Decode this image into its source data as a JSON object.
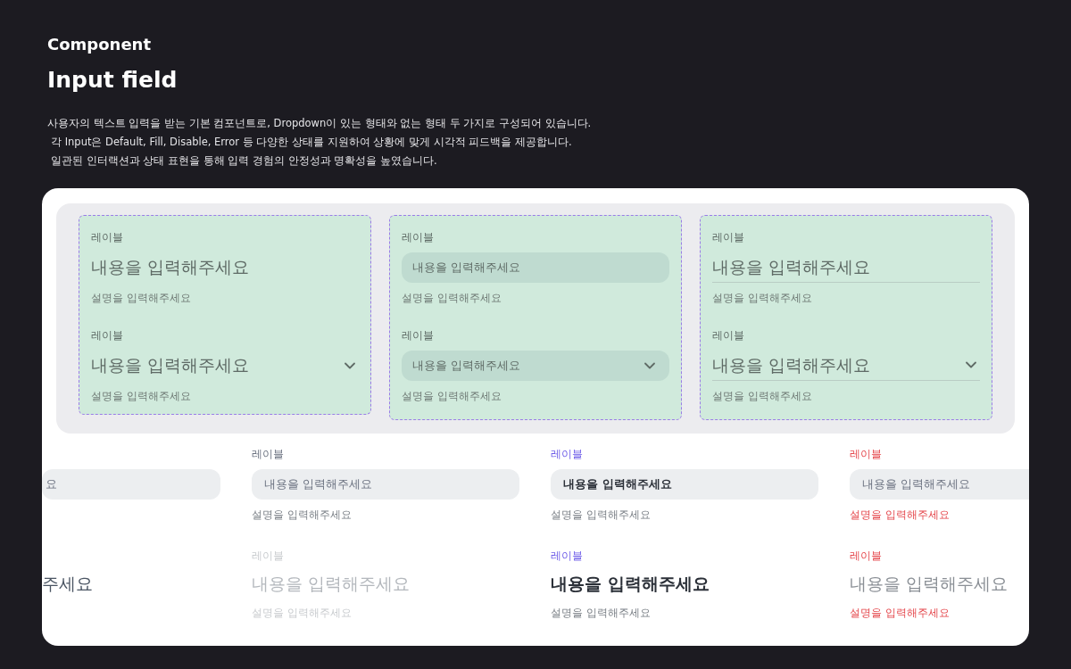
{
  "header": {
    "eyebrow": "Component",
    "title": "Input field",
    "description": [
      "사용자의 텍스트 입력을 받는 기본 컴포넌트로, Dropdown이 있는 형태와 없는 형태 두 가지로 구성되어 있습니다.",
      "각 Input은 Default, Fill, Disable, Error 등 다양한 상태를 지원하여 상황에 맞게 시각적 피드백을 제공합니다.",
      "일관된 인터랙션과 상태 표현을 통해 입력 경험의 안정성과 명확성을 높였습니다."
    ]
  },
  "variants": [
    {
      "kind": "plain",
      "fields": [
        {
          "label": "레이블",
          "value": "내용을 입력해주세요",
          "description": "설명을 입력해주세요",
          "dropdown": false
        },
        {
          "label": "레이블",
          "value": "내용을 입력해주세요",
          "description": "설명을 입력해주세요",
          "dropdown": true
        }
      ]
    },
    {
      "kind": "filled",
      "fields": [
        {
          "label": "레이블",
          "value": "내용을 입력해주세요",
          "description": "설명을 입력해주세요",
          "dropdown": false
        },
        {
          "label": "레이블",
          "value": "내용을 입력해주세요",
          "description": "설명을 입력해주세요",
          "dropdown": true
        }
      ]
    },
    {
      "kind": "underline",
      "fields": [
        {
          "label": "레이블",
          "value": "내용을 입력해주세요",
          "description": "설명을 입력해주세요",
          "dropdown": false
        },
        {
          "label": "레이블",
          "value": "내용을 입력해주세요",
          "description": "설명을 입력해주세요",
          "dropdown": true
        }
      ]
    }
  ],
  "state_columns": [
    {
      "box": {
        "kind": "default",
        "value": "요"
      },
      "line": {
        "kind": "filled",
        "value": "주세요"
      }
    },
    {
      "box": {
        "kind": "default",
        "label": "레이블",
        "value": "내용을 입력해주세요",
        "description": "설명을 입력해주세요"
      },
      "line": {
        "kind": "disabled",
        "label": "레이블",
        "value": "내용을 입력해주세요",
        "description": "설명을 입력해주세요"
      }
    },
    {
      "box": {
        "kind": "focused",
        "label": "레이블",
        "value": "내용을 입력해주세요",
        "description": "설명을 입력해주세요"
      },
      "line": {
        "kind": "focused",
        "label": "레이블",
        "value": "내용을 입력해주세요",
        "description": "설명을 입력해주세요"
      }
    },
    {
      "box": {
        "kind": "error",
        "label": "레이블",
        "value": "내용을 입력해주세요",
        "description": "설명을 입력해주세요"
      },
      "line": {
        "kind": "error",
        "label": "레이블",
        "value": "내용을 입력해주세요",
        "description": "설명을 입력해주세요"
      }
    }
  ]
}
